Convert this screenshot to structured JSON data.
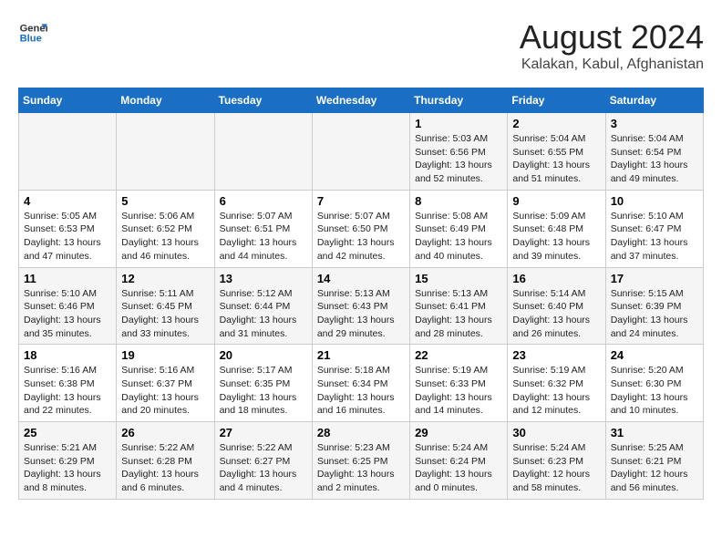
{
  "logo": {
    "line1": "General",
    "line2": "Blue"
  },
  "title": "August 2024",
  "subtitle": "Kalakan, Kabul, Afghanistan",
  "days_of_week": [
    "Sunday",
    "Monday",
    "Tuesday",
    "Wednesday",
    "Thursday",
    "Friday",
    "Saturday"
  ],
  "weeks": [
    [
      {
        "day": "",
        "info": ""
      },
      {
        "day": "",
        "info": ""
      },
      {
        "day": "",
        "info": ""
      },
      {
        "day": "",
        "info": ""
      },
      {
        "day": "1",
        "info": "Sunrise: 5:03 AM\nSunset: 6:56 PM\nDaylight: 13 hours\nand 52 minutes."
      },
      {
        "day": "2",
        "info": "Sunrise: 5:04 AM\nSunset: 6:55 PM\nDaylight: 13 hours\nand 51 minutes."
      },
      {
        "day": "3",
        "info": "Sunrise: 5:04 AM\nSunset: 6:54 PM\nDaylight: 13 hours\nand 49 minutes."
      }
    ],
    [
      {
        "day": "4",
        "info": "Sunrise: 5:05 AM\nSunset: 6:53 PM\nDaylight: 13 hours\nand 47 minutes."
      },
      {
        "day": "5",
        "info": "Sunrise: 5:06 AM\nSunset: 6:52 PM\nDaylight: 13 hours\nand 46 minutes."
      },
      {
        "day": "6",
        "info": "Sunrise: 5:07 AM\nSunset: 6:51 PM\nDaylight: 13 hours\nand 44 minutes."
      },
      {
        "day": "7",
        "info": "Sunrise: 5:07 AM\nSunset: 6:50 PM\nDaylight: 13 hours\nand 42 minutes."
      },
      {
        "day": "8",
        "info": "Sunrise: 5:08 AM\nSunset: 6:49 PM\nDaylight: 13 hours\nand 40 minutes."
      },
      {
        "day": "9",
        "info": "Sunrise: 5:09 AM\nSunset: 6:48 PM\nDaylight: 13 hours\nand 39 minutes."
      },
      {
        "day": "10",
        "info": "Sunrise: 5:10 AM\nSunset: 6:47 PM\nDaylight: 13 hours\nand 37 minutes."
      }
    ],
    [
      {
        "day": "11",
        "info": "Sunrise: 5:10 AM\nSunset: 6:46 PM\nDaylight: 13 hours\nand 35 minutes."
      },
      {
        "day": "12",
        "info": "Sunrise: 5:11 AM\nSunset: 6:45 PM\nDaylight: 13 hours\nand 33 minutes."
      },
      {
        "day": "13",
        "info": "Sunrise: 5:12 AM\nSunset: 6:44 PM\nDaylight: 13 hours\nand 31 minutes."
      },
      {
        "day": "14",
        "info": "Sunrise: 5:13 AM\nSunset: 6:43 PM\nDaylight: 13 hours\nand 29 minutes."
      },
      {
        "day": "15",
        "info": "Sunrise: 5:13 AM\nSunset: 6:41 PM\nDaylight: 13 hours\nand 28 minutes."
      },
      {
        "day": "16",
        "info": "Sunrise: 5:14 AM\nSunset: 6:40 PM\nDaylight: 13 hours\nand 26 minutes."
      },
      {
        "day": "17",
        "info": "Sunrise: 5:15 AM\nSunset: 6:39 PM\nDaylight: 13 hours\nand 24 minutes."
      }
    ],
    [
      {
        "day": "18",
        "info": "Sunrise: 5:16 AM\nSunset: 6:38 PM\nDaylight: 13 hours\nand 22 minutes."
      },
      {
        "day": "19",
        "info": "Sunrise: 5:16 AM\nSunset: 6:37 PM\nDaylight: 13 hours\nand 20 minutes."
      },
      {
        "day": "20",
        "info": "Sunrise: 5:17 AM\nSunset: 6:35 PM\nDaylight: 13 hours\nand 18 minutes."
      },
      {
        "day": "21",
        "info": "Sunrise: 5:18 AM\nSunset: 6:34 PM\nDaylight: 13 hours\nand 16 minutes."
      },
      {
        "day": "22",
        "info": "Sunrise: 5:19 AM\nSunset: 6:33 PM\nDaylight: 13 hours\nand 14 minutes."
      },
      {
        "day": "23",
        "info": "Sunrise: 5:19 AM\nSunset: 6:32 PM\nDaylight: 13 hours\nand 12 minutes."
      },
      {
        "day": "24",
        "info": "Sunrise: 5:20 AM\nSunset: 6:30 PM\nDaylight: 13 hours\nand 10 minutes."
      }
    ],
    [
      {
        "day": "25",
        "info": "Sunrise: 5:21 AM\nSunset: 6:29 PM\nDaylight: 13 hours\nand 8 minutes."
      },
      {
        "day": "26",
        "info": "Sunrise: 5:22 AM\nSunset: 6:28 PM\nDaylight: 13 hours\nand 6 minutes."
      },
      {
        "day": "27",
        "info": "Sunrise: 5:22 AM\nSunset: 6:27 PM\nDaylight: 13 hours\nand 4 minutes."
      },
      {
        "day": "28",
        "info": "Sunrise: 5:23 AM\nSunset: 6:25 PM\nDaylight: 13 hours\nand 2 minutes."
      },
      {
        "day": "29",
        "info": "Sunrise: 5:24 AM\nSunset: 6:24 PM\nDaylight: 13 hours\nand 0 minutes."
      },
      {
        "day": "30",
        "info": "Sunrise: 5:24 AM\nSunset: 6:23 PM\nDaylight: 12 hours\nand 58 minutes."
      },
      {
        "day": "31",
        "info": "Sunrise: 5:25 AM\nSunset: 6:21 PM\nDaylight: 12 hours\nand 56 minutes."
      }
    ]
  ]
}
